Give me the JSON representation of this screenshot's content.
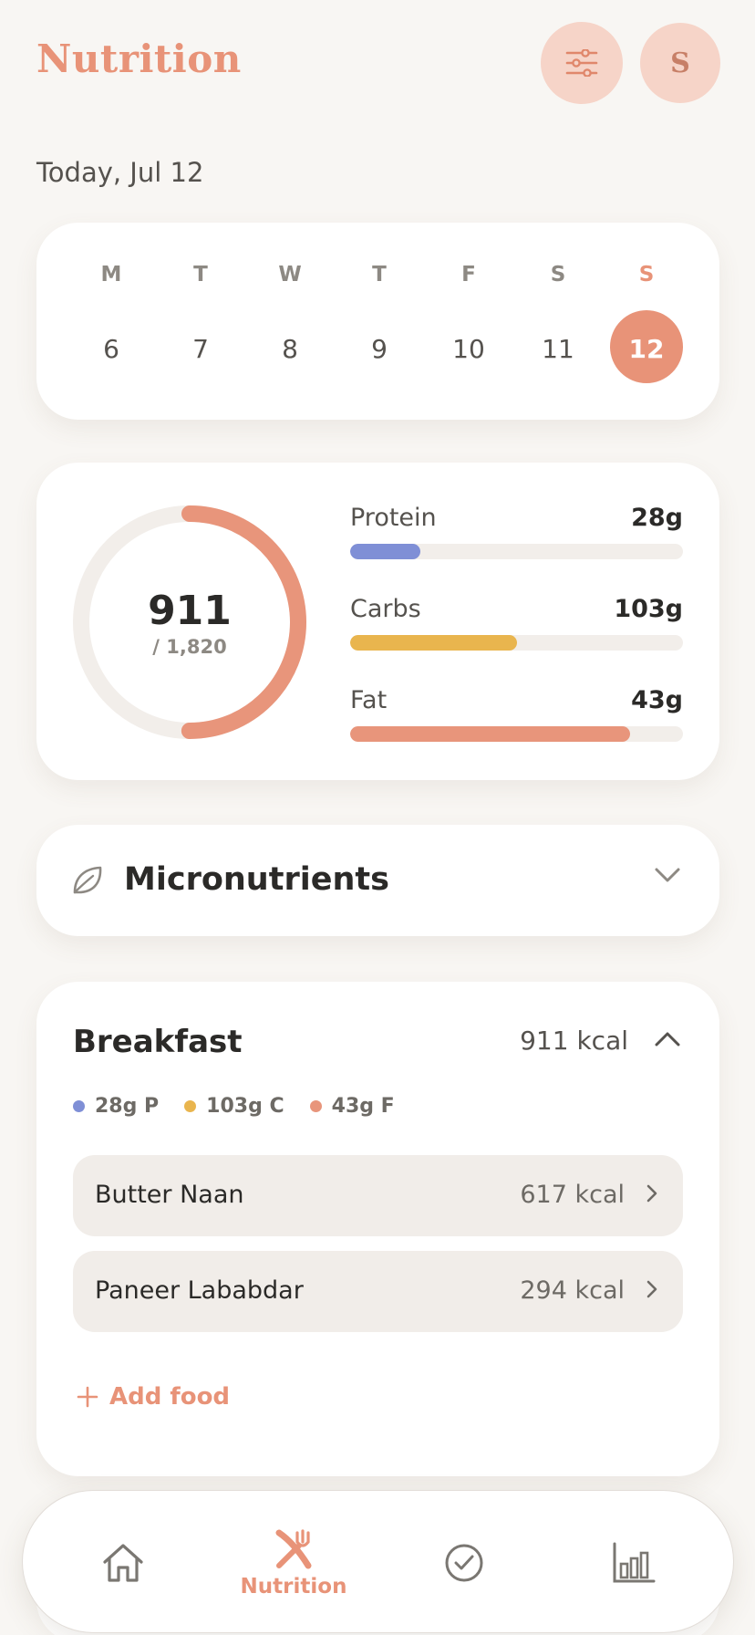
{
  "header": {
    "title": "Nutrition",
    "avatar_initial": "S",
    "filter_icon": "sliders-icon"
  },
  "date_label": "Today, Jul 12",
  "week": {
    "days": [
      {
        "letter": "M",
        "number": "6",
        "active": false
      },
      {
        "letter": "T",
        "number": "7",
        "active": false
      },
      {
        "letter": "W",
        "number": "8",
        "active": false
      },
      {
        "letter": "T",
        "number": "9",
        "active": false
      },
      {
        "letter": "F",
        "number": "10",
        "active": false
      },
      {
        "letter": "S",
        "number": "11",
        "active": false
      },
      {
        "letter": "S",
        "number": "12",
        "active": true
      }
    ]
  },
  "summary": {
    "calories_consumed": "911",
    "calories_goal": "/ 1,820",
    "progress_fraction": 0.5,
    "macros": [
      {
        "name": "Protein",
        "value": "28g",
        "fill_fraction": 0.21,
        "color": "#7f8fd6"
      },
      {
        "name": "Carbs",
        "value": "103g",
        "fill_fraction": 0.5,
        "color": "#e9b54e"
      },
      {
        "name": "Fat",
        "value": "43g",
        "fill_fraction": 0.84,
        "color": "#e8957b"
      }
    ]
  },
  "micronutrients": {
    "title": "Micronutrients",
    "icon": "leaf-icon",
    "expanded": false
  },
  "meal": {
    "title": "Breakfast",
    "kcal": "911 kcal",
    "expanded": true,
    "chips": [
      {
        "label": "28g P",
        "color": "#7f8fd6"
      },
      {
        "label": "103g C",
        "color": "#e9b54e"
      },
      {
        "label": "43g F",
        "color": "#e8957b"
      }
    ],
    "foods": [
      {
        "name": "Butter Naan",
        "kcal": "617 kcal"
      },
      {
        "name": "Paneer Lababdar",
        "kcal": "294 kcal"
      }
    ],
    "add_label": "Add food"
  },
  "nav": {
    "items": [
      {
        "icon": "home-icon",
        "label": "",
        "active": false
      },
      {
        "icon": "fork-knife-icon",
        "label": "Nutrition",
        "active": true
      },
      {
        "icon": "check-circle-icon",
        "label": "",
        "active": false
      },
      {
        "icon": "bar-chart-icon",
        "label": "",
        "active": false
      }
    ]
  },
  "colors": {
    "accent": "#e89378",
    "accent_soft": "#f6d4c8",
    "background": "#f8f6f3",
    "card": "#ffffff"
  }
}
